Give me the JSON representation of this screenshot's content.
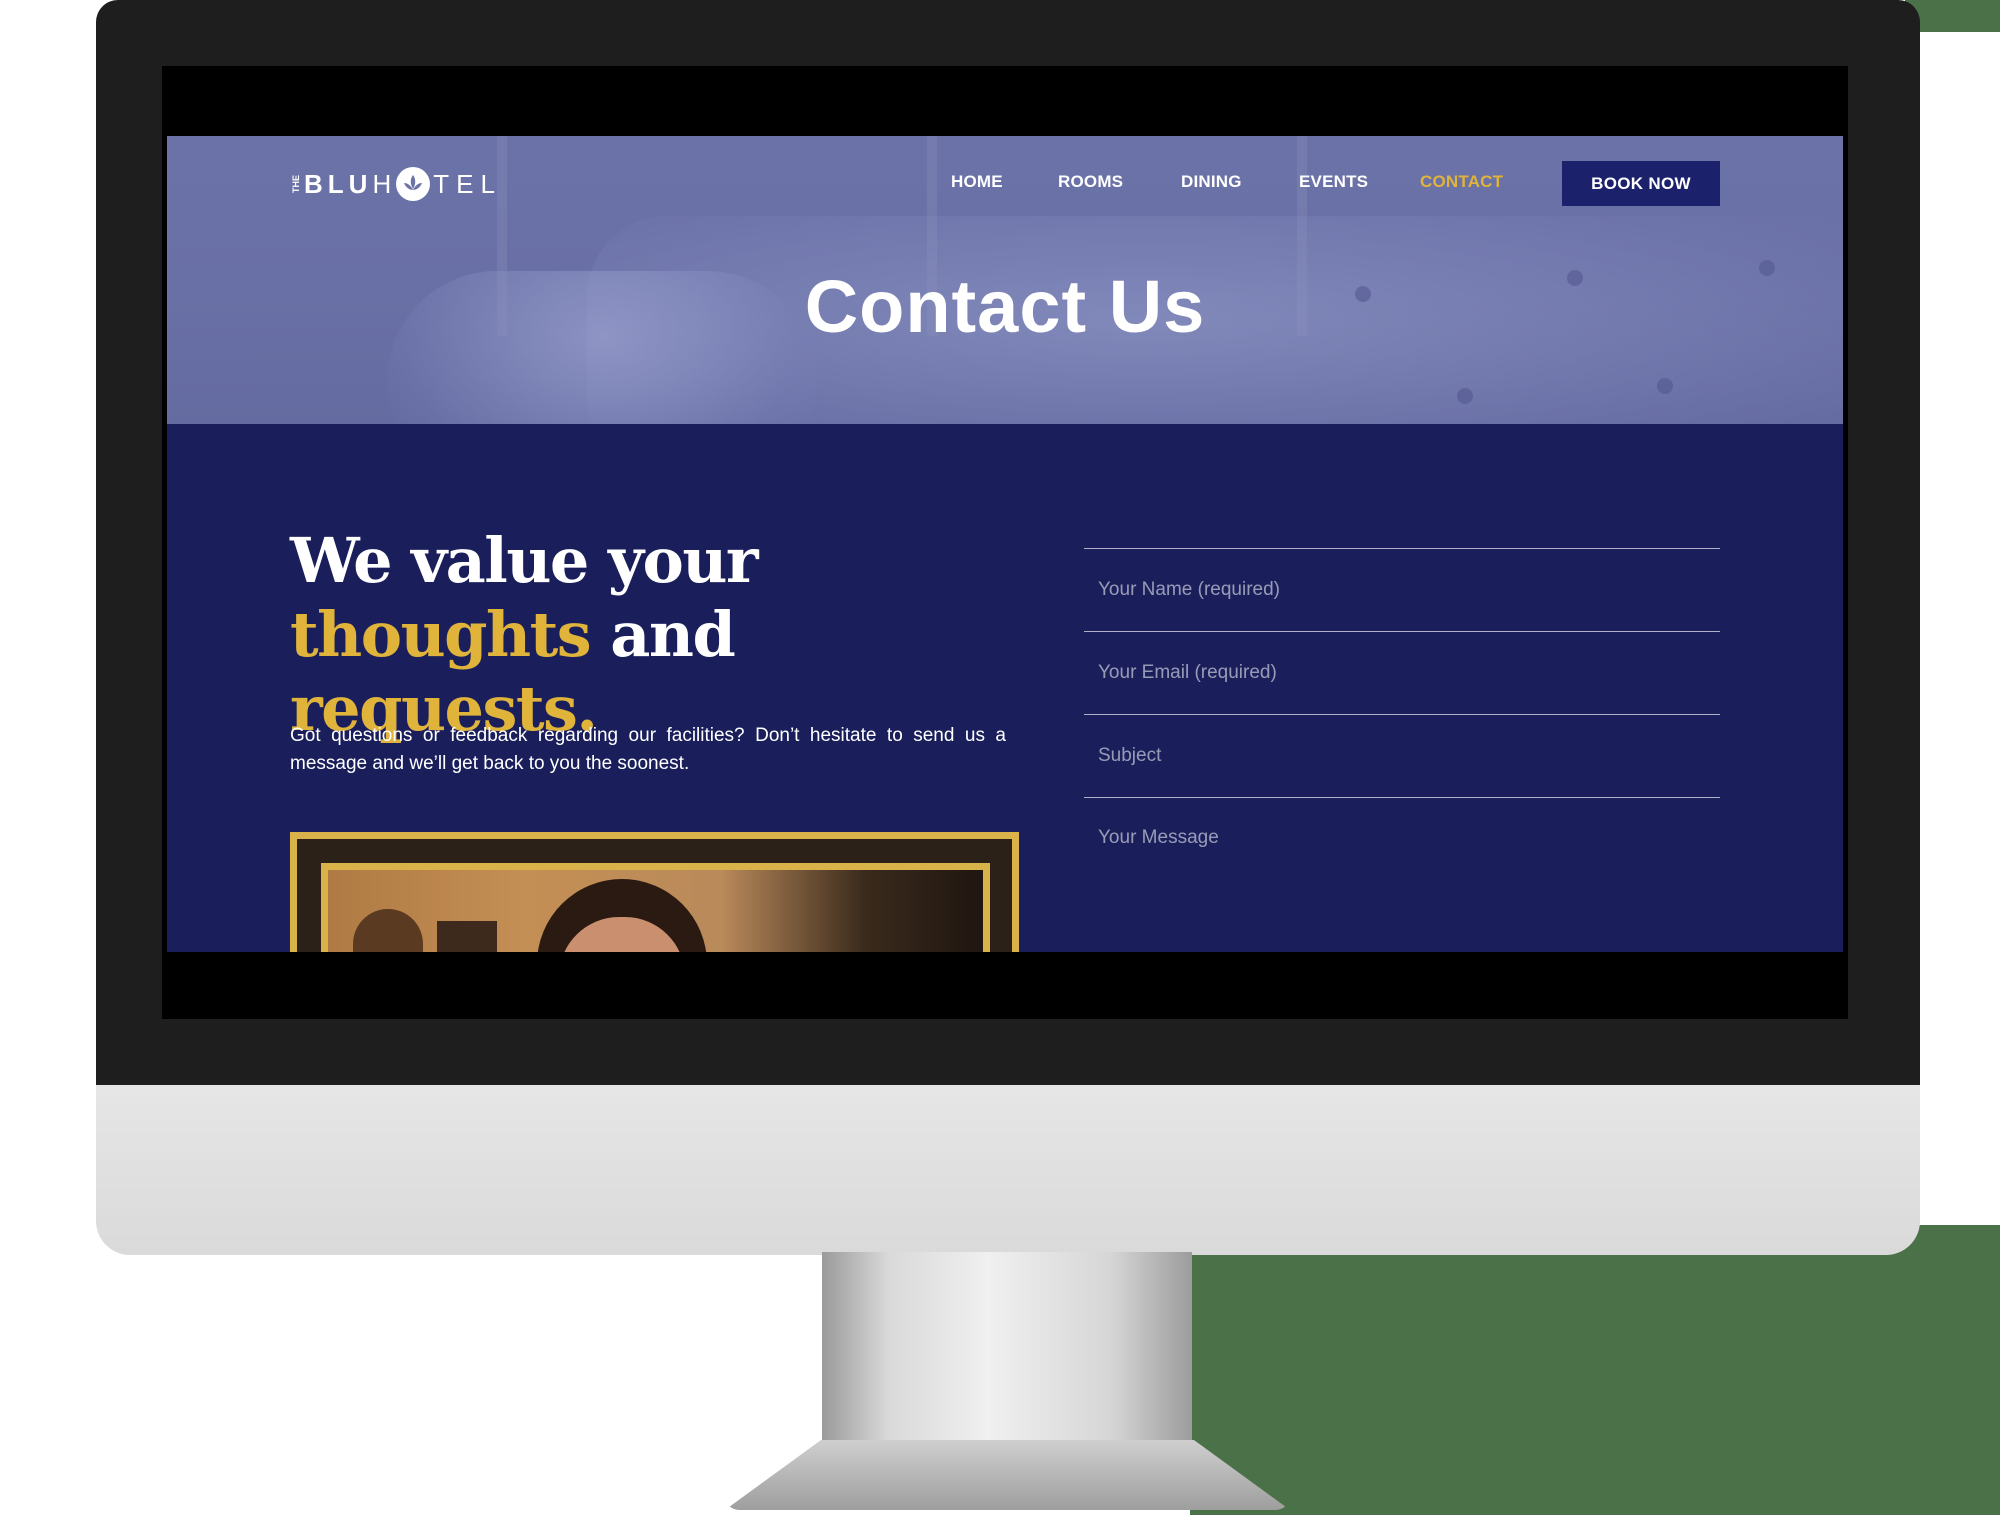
{
  "brand": {
    "logo_the": "THE",
    "logo_blu": "BLU",
    "logo_h": "H",
    "logo_tel": "TEL"
  },
  "nav": {
    "items": [
      {
        "label": "HOME",
        "active": false
      },
      {
        "label": "ROOMS",
        "active": false
      },
      {
        "label": "DINING",
        "active": false
      },
      {
        "label": "EVENTS",
        "active": false
      },
      {
        "label": "CONTACT",
        "active": true
      }
    ],
    "cta_label": "BOOK NOW"
  },
  "hero": {
    "title": "Contact Us"
  },
  "content": {
    "headline": {
      "line1": "We value your",
      "word_thoughts": "thoughts",
      "word_and": "and",
      "word_requests": "requests."
    },
    "intro": "Got questions or feedback regarding our facilities? Don’t hesitate to send us a message and we’ll get back to you the soonest."
  },
  "form": {
    "name_placeholder": "Your Name (required)",
    "email_placeholder": "Your Email (required)",
    "subject_placeholder": "Subject",
    "message_placeholder": "Your Message"
  },
  "icons": {
    "logo": "lotus-logo-icon",
    "chat": "messenger-icon"
  },
  "colors": {
    "accent_gold": "#e0b43a",
    "navy": "#1a1f5c",
    "button_navy": "#1b216b",
    "hero_overlay": "#6b72a8"
  }
}
